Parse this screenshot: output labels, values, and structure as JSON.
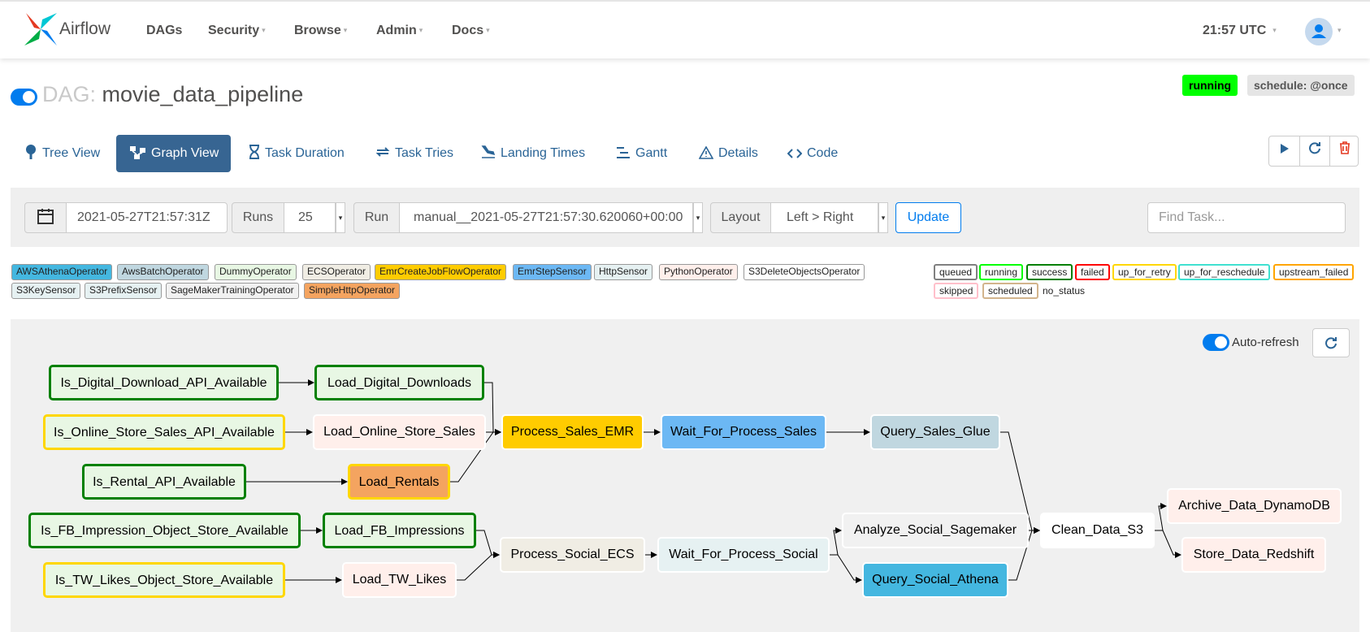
{
  "nav": {
    "brand": "Airflow",
    "items": [
      {
        "label": "DAGs",
        "caret": ""
      },
      {
        "label": "Security",
        "caret": "▾"
      },
      {
        "label": "Browse",
        "caret": "▾"
      },
      {
        "label": "Admin",
        "caret": "▾"
      },
      {
        "label": "Docs",
        "caret": "▾"
      }
    ],
    "time": "21:57 UTC",
    "time_caret": "▾",
    "user_caret": "▾"
  },
  "dag": {
    "prefix": "DAG:",
    "name": "movie_data_pipeline",
    "state": "running",
    "schedule": "schedule: @once",
    "paused": false
  },
  "tabs": [
    {
      "label": "Tree View",
      "icon": "tree-icon"
    },
    {
      "label": "Graph View",
      "icon": "graph-icon",
      "active": true
    },
    {
      "label": "Task Duration",
      "icon": "hourglass-icon"
    },
    {
      "label": "Task Tries",
      "icon": "retry-icon"
    },
    {
      "label": "Landing Times",
      "icon": "plane-landing-icon"
    },
    {
      "label": "Gantt",
      "icon": "gantt-icon"
    },
    {
      "label": "Details",
      "icon": "warning-icon"
    },
    {
      "label": "Code",
      "icon": "code-icon"
    }
  ],
  "actions": {
    "trigger": "play-icon",
    "refresh": "refresh-icon",
    "delete": "trash-icon"
  },
  "filters": {
    "base_date": "2021-05-27T21:57:31Z",
    "runs_label": "Runs",
    "runs_value": "25",
    "run_label": "Run",
    "run_value": "manual__2021-05-27T21:57:30.620060+00:00",
    "layout_label": "Layout",
    "layout_value": "Left > Right",
    "update_label": "Update",
    "find_placeholder": "Find Task..."
  },
  "operator_legend": [
    {
      "label": "AWSAthenaOperator",
      "color": "#44b7e0"
    },
    {
      "label": "AwsBatchOperator",
      "color": "#c0d7e0"
    },
    {
      "label": "DummyOperator",
      "color": "#e8f7e4"
    },
    {
      "label": "ECSOperator",
      "color": "#f0ede4"
    },
    {
      "label": "EmrCreateJobFlowOperator",
      "color": "#ffcc00"
    },
    {
      "label": "EmrStepSensor",
      "color": "#6cb8f4"
    },
    {
      "label": "HttpSensor",
      "color": "#e6f1f2"
    },
    {
      "label": "PythonOperator",
      "color": "#ffefeb"
    },
    {
      "label": "S3DeleteObjectsOperator",
      "color": "#ffffff"
    },
    {
      "label": "S3KeySensor",
      "color": "#e6f1f2"
    },
    {
      "label": "S3PrefixSensor",
      "color": "#e6f1f2"
    },
    {
      "label": "SageMakerTrainingOperator",
      "color": "#f1f1f1"
    },
    {
      "label": "SimpleHttpOperator",
      "color": "#f4a460"
    }
  ],
  "state_legend": [
    {
      "label": "queued",
      "color": "#808080"
    },
    {
      "label": "running",
      "color": "#00ff00"
    },
    {
      "label": "success",
      "color": "#008000"
    },
    {
      "label": "failed",
      "color": "#ff0000"
    },
    {
      "label": "up_for_retry",
      "color": "#ffd700"
    },
    {
      "label": "up_for_reschedule",
      "color": "#40e0d0"
    },
    {
      "label": "upstream_failed",
      "color": "#ffa500"
    },
    {
      "label": "skipped",
      "color": "#ffc0cb"
    },
    {
      "label": "scheduled",
      "color": "#d2b48c"
    },
    {
      "label": "no_status",
      "color": ""
    }
  ],
  "graph": {
    "auto_refresh_label": "Auto-refresh",
    "auto_refresh_on": true,
    "nodes": [
      {
        "id": "n1",
        "label": "Is_Digital_Download_API_Available",
        "fill": "#e8f7e4",
        "border": "#008000"
      },
      {
        "id": "n2",
        "label": "Load_Digital_Downloads",
        "fill": "#e8f7e4",
        "border": "#008000"
      },
      {
        "id": "n3",
        "label": "Is_Online_Store_Sales_API_Available",
        "fill": "#e8f7e4",
        "border": "#ffd700"
      },
      {
        "id": "n4",
        "label": "Load_Online_Store_Sales",
        "fill": "#ffefeb",
        "border": "#ffffff"
      },
      {
        "id": "n5",
        "label": "Process_Sales_EMR",
        "fill": "#ffcc00",
        "border": "#ffffff"
      },
      {
        "id": "n6",
        "label": "Wait_For_Process_Sales",
        "fill": "#6cb8f4",
        "border": "#ffffff"
      },
      {
        "id": "n7",
        "label": "Query_Sales_Glue",
        "fill": "#c0d7e0",
        "border": "#ffffff"
      },
      {
        "id": "n8",
        "label": "Is_Rental_API_Available",
        "fill": "#e8f7e4",
        "border": "#008000"
      },
      {
        "id": "n9",
        "label": "Load_Rentals",
        "fill": "#f4a460",
        "border": "#ffd700"
      },
      {
        "id": "n10",
        "label": "Is_FB_Impression_Object_Store_Available",
        "fill": "#e8f7e4",
        "border": "#008000"
      },
      {
        "id": "n11",
        "label": "Load_FB_Impressions",
        "fill": "#e8f7e4",
        "border": "#008000"
      },
      {
        "id": "n12",
        "label": "Process_Social_ECS",
        "fill": "#f0ede4",
        "border": "#ffffff"
      },
      {
        "id": "n13",
        "label": "Wait_For_Process_Social",
        "fill": "#e6f1f2",
        "border": "#ffffff"
      },
      {
        "id": "n14",
        "label": "Analyze_Social_Sagemaker",
        "fill": "#f1f1f1",
        "border": "#ffffff"
      },
      {
        "id": "n15",
        "label": "Query_Social_Athena",
        "fill": "#44b7e0",
        "border": "#ffffff"
      },
      {
        "id": "n16",
        "label": "Clean_Data_S3",
        "fill": "#ffffff",
        "border": "#ffffff"
      },
      {
        "id": "n17",
        "label": "Archive_Data_DynamoDB",
        "fill": "#ffefeb",
        "border": "#ffffff"
      },
      {
        "id": "n18",
        "label": "Store_Data_Redshift",
        "fill": "#ffefeb",
        "border": "#ffffff"
      },
      {
        "id": "n19",
        "label": "Is_TW_Likes_Object_Store_Available",
        "fill": "#e8f7e4",
        "border": "#ffd700"
      },
      {
        "id": "n20",
        "label": "Load_TW_Likes",
        "fill": "#ffefeb",
        "border": "#ffffff"
      }
    ],
    "edges": [
      [
        "n1",
        "n2"
      ],
      [
        "n2",
        "n5"
      ],
      [
        "n3",
        "n4"
      ],
      [
        "n4",
        "n5"
      ],
      [
        "n8",
        "n9"
      ],
      [
        "n9",
        "n5"
      ],
      [
        "n5",
        "n6"
      ],
      [
        "n6",
        "n7"
      ],
      [
        "n7",
        "n16"
      ],
      [
        "n10",
        "n11"
      ],
      [
        "n11",
        "n12"
      ],
      [
        "n19",
        "n20"
      ],
      [
        "n20",
        "n12"
      ],
      [
        "n12",
        "n13"
      ],
      [
        "n13",
        "n14"
      ],
      [
        "n13",
        "n15"
      ],
      [
        "n14",
        "n16"
      ],
      [
        "n15",
        "n16"
      ],
      [
        "n16",
        "n17"
      ],
      [
        "n16",
        "n18"
      ]
    ]
  }
}
